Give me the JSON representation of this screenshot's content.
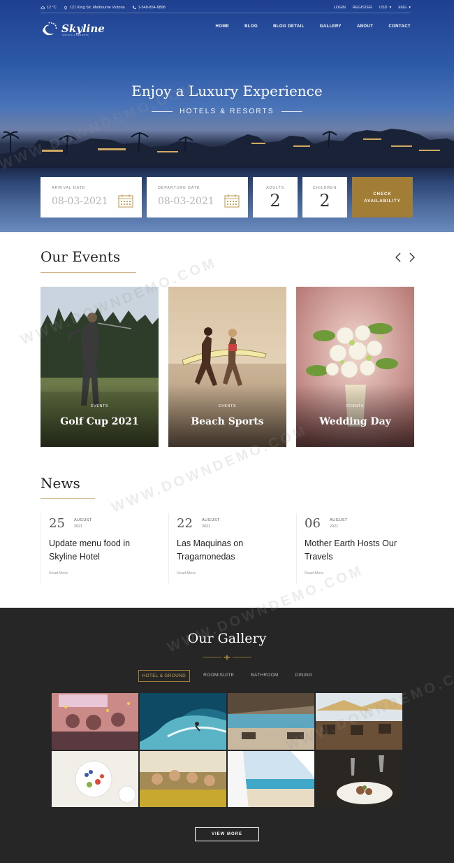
{
  "topbar": {
    "weather": "12 °C",
    "address": "121 King Str, Melbourne Victoria",
    "phone": "1-548-854-8898",
    "login": "LOGIN",
    "register": "REGISTER",
    "currency": "USD",
    "language": "ENG"
  },
  "brand": {
    "name": "Skyline",
    "tagline": "HOTELS & RESORTS"
  },
  "nav": {
    "items": [
      "HOME",
      "BLOG",
      "BLOG DETAIL",
      "GALLERY",
      "ABOUT",
      "CONTACT"
    ]
  },
  "hero": {
    "title": "Enjoy a Luxury Experience",
    "subtitle": "HOTELS & RESORTS"
  },
  "booking": {
    "arrival_label": "ARRIVAL DATE",
    "arrival_value": "08-03-2021",
    "departure_label": "DEPARTURE DATE",
    "departure_value": "08-03-2021",
    "adults_label": "ADULTS",
    "adults_value": "2",
    "children_label": "CHILDREN",
    "children_value": "2",
    "check_line1": "CHECK",
    "check_line2": "AVAILABILITY"
  },
  "events": {
    "title": "Our Events",
    "cards": [
      {
        "tag": "EVENTS",
        "name": "Golf Cup 2021"
      },
      {
        "tag": "EVENTS",
        "name": "Beach Sports"
      },
      {
        "tag": "EVENTS",
        "name": "Wedding Day"
      }
    ]
  },
  "news": {
    "title": "News",
    "items": [
      {
        "day": "25",
        "month": "AUGUST",
        "year": "2021",
        "headline": "Update menu food in Skyline Hotel",
        "more": "Read More"
      },
      {
        "day": "22",
        "month": "AUGUST",
        "year": "2021",
        "headline": "Las Maquinas on Tragamonedas",
        "more": "Read More"
      },
      {
        "day": "06",
        "month": "AUGUST",
        "year": "2021",
        "headline": "Mother Earth Hosts Our Travels",
        "more": "Read More"
      }
    ]
  },
  "gallery": {
    "title": "Our Gallery",
    "filters": [
      "HOTEL & GROUND",
      "ROOM/SUITE",
      "BATHROOM",
      "DINING"
    ],
    "active_filter": "HOTEL & GROUND",
    "view_more": "VIEW MORE"
  },
  "watermark": "WWW.DOWNDEMO.COM",
  "colors": {
    "accent": "#a17d35",
    "dark": "#262626",
    "hero_blue": "#2d5aa8"
  }
}
